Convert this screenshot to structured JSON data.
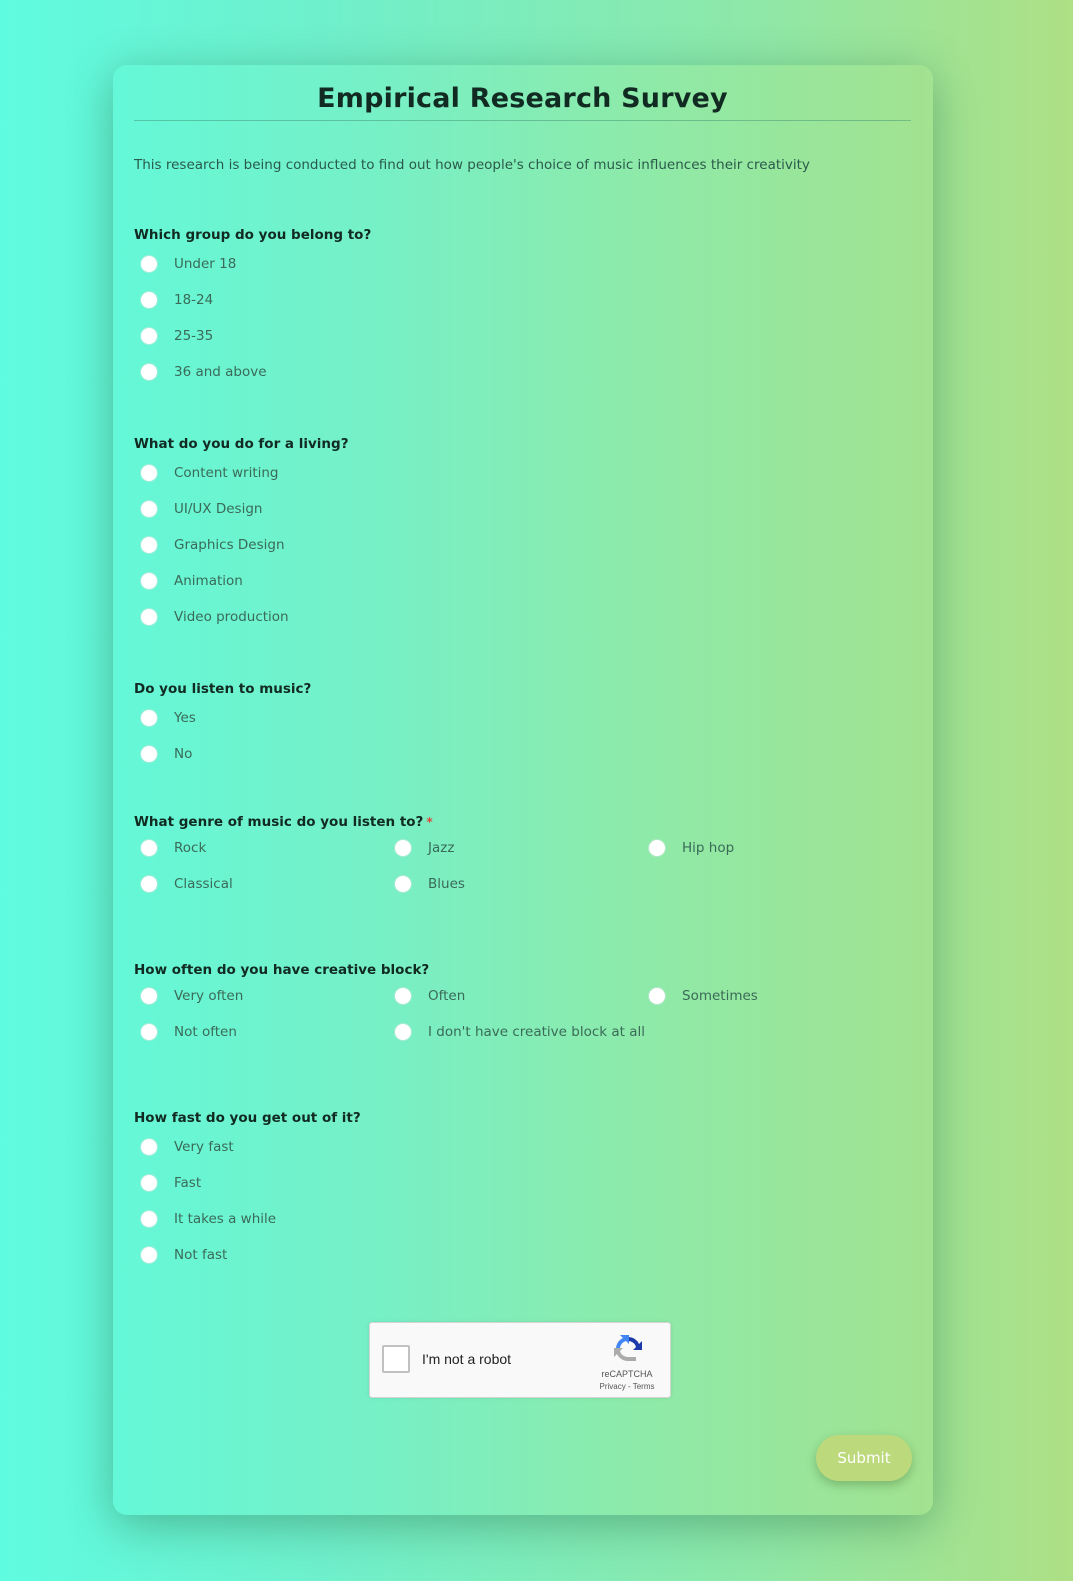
{
  "form": {
    "title": "Empirical Research Survey",
    "description": "This research is being conducted to find out how people's choice of music influences their creativity",
    "questions": [
      {
        "label": "Which group do you belong to?",
        "required": false,
        "options": [
          "Under 18",
          "18-24",
          "25-35",
          "36 and above"
        ]
      },
      {
        "label": "What do you do for a living?",
        "required": false,
        "options": [
          "Content writing",
          "UI/UX Design",
          "Graphics Design",
          "Animation",
          "Video production"
        ]
      },
      {
        "label": "Do you listen to music?",
        "required": false,
        "options": [
          "Yes",
          "No"
        ]
      },
      {
        "label": "What genre of music do you listen to?",
        "required": true,
        "required_mark": "*",
        "options": [
          "Rock",
          "Jazz",
          "Hip hop",
          "Classical",
          "Blues"
        ]
      },
      {
        "label": "How often do you have creative block?",
        "required": false,
        "options": [
          "Very often",
          "Often",
          "Sometimes",
          "Not often",
          "I don't have creative block at all"
        ]
      },
      {
        "label": "How fast do you get out of it?",
        "required": false,
        "options": [
          "Very fast",
          "Fast",
          "It takes a while",
          "Not fast"
        ]
      }
    ]
  },
  "captcha": {
    "label": "I'm not a robot",
    "brand": "reCAPTCHA",
    "privacy": "Privacy",
    "separator": "-",
    "terms": "Terms",
    "checked": false
  },
  "submit": {
    "label": "Submit"
  },
  "colors": {
    "submit_bg": "#bcd97c",
    "required_mark": "#e2453c",
    "title_text": "#112a22"
  }
}
